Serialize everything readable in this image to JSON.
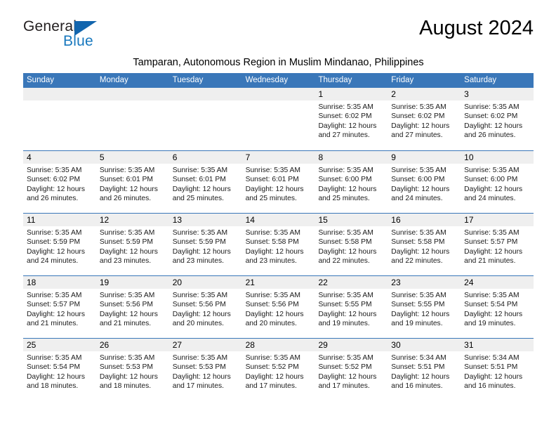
{
  "brand": {
    "name_part1": "General",
    "name_part2": "Blue",
    "accent_color": "#1265ad",
    "text_color": "#231f20"
  },
  "header": {
    "month_title": "August 2024",
    "subtitle": "Tamparan, Autonomous Region in Muslim Mindanao, Philippines",
    "header_bg_color": "#3a77b9",
    "day_strip_color": "#efefef"
  },
  "calendar": {
    "weekdays": [
      "Sunday",
      "Monday",
      "Tuesday",
      "Wednesday",
      "Thursday",
      "Friday",
      "Saturday"
    ],
    "weeks": [
      [
        {
          "day": "",
          "sunrise": "",
          "sunset": "",
          "daylight1": "",
          "daylight2": ""
        },
        {
          "day": "",
          "sunrise": "",
          "sunset": "",
          "daylight1": "",
          "daylight2": ""
        },
        {
          "day": "",
          "sunrise": "",
          "sunset": "",
          "daylight1": "",
          "daylight2": ""
        },
        {
          "day": "",
          "sunrise": "",
          "sunset": "",
          "daylight1": "",
          "daylight2": ""
        },
        {
          "day": "1",
          "sunrise": "Sunrise: 5:35 AM",
          "sunset": "Sunset: 6:02 PM",
          "daylight1": "Daylight: 12 hours",
          "daylight2": "and 27 minutes."
        },
        {
          "day": "2",
          "sunrise": "Sunrise: 5:35 AM",
          "sunset": "Sunset: 6:02 PM",
          "daylight1": "Daylight: 12 hours",
          "daylight2": "and 27 minutes."
        },
        {
          "day": "3",
          "sunrise": "Sunrise: 5:35 AM",
          "sunset": "Sunset: 6:02 PM",
          "daylight1": "Daylight: 12 hours",
          "daylight2": "and 26 minutes."
        }
      ],
      [
        {
          "day": "4",
          "sunrise": "Sunrise: 5:35 AM",
          "sunset": "Sunset: 6:02 PM",
          "daylight1": "Daylight: 12 hours",
          "daylight2": "and 26 minutes."
        },
        {
          "day": "5",
          "sunrise": "Sunrise: 5:35 AM",
          "sunset": "Sunset: 6:01 PM",
          "daylight1": "Daylight: 12 hours",
          "daylight2": "and 26 minutes."
        },
        {
          "day": "6",
          "sunrise": "Sunrise: 5:35 AM",
          "sunset": "Sunset: 6:01 PM",
          "daylight1": "Daylight: 12 hours",
          "daylight2": "and 25 minutes."
        },
        {
          "day": "7",
          "sunrise": "Sunrise: 5:35 AM",
          "sunset": "Sunset: 6:01 PM",
          "daylight1": "Daylight: 12 hours",
          "daylight2": "and 25 minutes."
        },
        {
          "day": "8",
          "sunrise": "Sunrise: 5:35 AM",
          "sunset": "Sunset: 6:00 PM",
          "daylight1": "Daylight: 12 hours",
          "daylight2": "and 25 minutes."
        },
        {
          "day": "9",
          "sunrise": "Sunrise: 5:35 AM",
          "sunset": "Sunset: 6:00 PM",
          "daylight1": "Daylight: 12 hours",
          "daylight2": "and 24 minutes."
        },
        {
          "day": "10",
          "sunrise": "Sunrise: 5:35 AM",
          "sunset": "Sunset: 6:00 PM",
          "daylight1": "Daylight: 12 hours",
          "daylight2": "and 24 minutes."
        }
      ],
      [
        {
          "day": "11",
          "sunrise": "Sunrise: 5:35 AM",
          "sunset": "Sunset: 5:59 PM",
          "daylight1": "Daylight: 12 hours",
          "daylight2": "and 24 minutes."
        },
        {
          "day": "12",
          "sunrise": "Sunrise: 5:35 AM",
          "sunset": "Sunset: 5:59 PM",
          "daylight1": "Daylight: 12 hours",
          "daylight2": "and 23 minutes."
        },
        {
          "day": "13",
          "sunrise": "Sunrise: 5:35 AM",
          "sunset": "Sunset: 5:59 PM",
          "daylight1": "Daylight: 12 hours",
          "daylight2": "and 23 minutes."
        },
        {
          "day": "14",
          "sunrise": "Sunrise: 5:35 AM",
          "sunset": "Sunset: 5:58 PM",
          "daylight1": "Daylight: 12 hours",
          "daylight2": "and 23 minutes."
        },
        {
          "day": "15",
          "sunrise": "Sunrise: 5:35 AM",
          "sunset": "Sunset: 5:58 PM",
          "daylight1": "Daylight: 12 hours",
          "daylight2": "and 22 minutes."
        },
        {
          "day": "16",
          "sunrise": "Sunrise: 5:35 AM",
          "sunset": "Sunset: 5:58 PM",
          "daylight1": "Daylight: 12 hours",
          "daylight2": "and 22 minutes."
        },
        {
          "day": "17",
          "sunrise": "Sunrise: 5:35 AM",
          "sunset": "Sunset: 5:57 PM",
          "daylight1": "Daylight: 12 hours",
          "daylight2": "and 21 minutes."
        }
      ],
      [
        {
          "day": "18",
          "sunrise": "Sunrise: 5:35 AM",
          "sunset": "Sunset: 5:57 PM",
          "daylight1": "Daylight: 12 hours",
          "daylight2": "and 21 minutes."
        },
        {
          "day": "19",
          "sunrise": "Sunrise: 5:35 AM",
          "sunset": "Sunset: 5:56 PM",
          "daylight1": "Daylight: 12 hours",
          "daylight2": "and 21 minutes."
        },
        {
          "day": "20",
          "sunrise": "Sunrise: 5:35 AM",
          "sunset": "Sunset: 5:56 PM",
          "daylight1": "Daylight: 12 hours",
          "daylight2": "and 20 minutes."
        },
        {
          "day": "21",
          "sunrise": "Sunrise: 5:35 AM",
          "sunset": "Sunset: 5:56 PM",
          "daylight1": "Daylight: 12 hours",
          "daylight2": "and 20 minutes."
        },
        {
          "day": "22",
          "sunrise": "Sunrise: 5:35 AM",
          "sunset": "Sunset: 5:55 PM",
          "daylight1": "Daylight: 12 hours",
          "daylight2": "and 19 minutes."
        },
        {
          "day": "23",
          "sunrise": "Sunrise: 5:35 AM",
          "sunset": "Sunset: 5:55 PM",
          "daylight1": "Daylight: 12 hours",
          "daylight2": "and 19 minutes."
        },
        {
          "day": "24",
          "sunrise": "Sunrise: 5:35 AM",
          "sunset": "Sunset: 5:54 PM",
          "daylight1": "Daylight: 12 hours",
          "daylight2": "and 19 minutes."
        }
      ],
      [
        {
          "day": "25",
          "sunrise": "Sunrise: 5:35 AM",
          "sunset": "Sunset: 5:54 PM",
          "daylight1": "Daylight: 12 hours",
          "daylight2": "and 18 minutes."
        },
        {
          "day": "26",
          "sunrise": "Sunrise: 5:35 AM",
          "sunset": "Sunset: 5:53 PM",
          "daylight1": "Daylight: 12 hours",
          "daylight2": "and 18 minutes."
        },
        {
          "day": "27",
          "sunrise": "Sunrise: 5:35 AM",
          "sunset": "Sunset: 5:53 PM",
          "daylight1": "Daylight: 12 hours",
          "daylight2": "and 17 minutes."
        },
        {
          "day": "28",
          "sunrise": "Sunrise: 5:35 AM",
          "sunset": "Sunset: 5:52 PM",
          "daylight1": "Daylight: 12 hours",
          "daylight2": "and 17 minutes."
        },
        {
          "day": "29",
          "sunrise": "Sunrise: 5:35 AM",
          "sunset": "Sunset: 5:52 PM",
          "daylight1": "Daylight: 12 hours",
          "daylight2": "and 17 minutes."
        },
        {
          "day": "30",
          "sunrise": "Sunrise: 5:34 AM",
          "sunset": "Sunset: 5:51 PM",
          "daylight1": "Daylight: 12 hours",
          "daylight2": "and 16 minutes."
        },
        {
          "day": "31",
          "sunrise": "Sunrise: 5:34 AM",
          "sunset": "Sunset: 5:51 PM",
          "daylight1": "Daylight: 12 hours",
          "daylight2": "and 16 minutes."
        }
      ]
    ]
  }
}
